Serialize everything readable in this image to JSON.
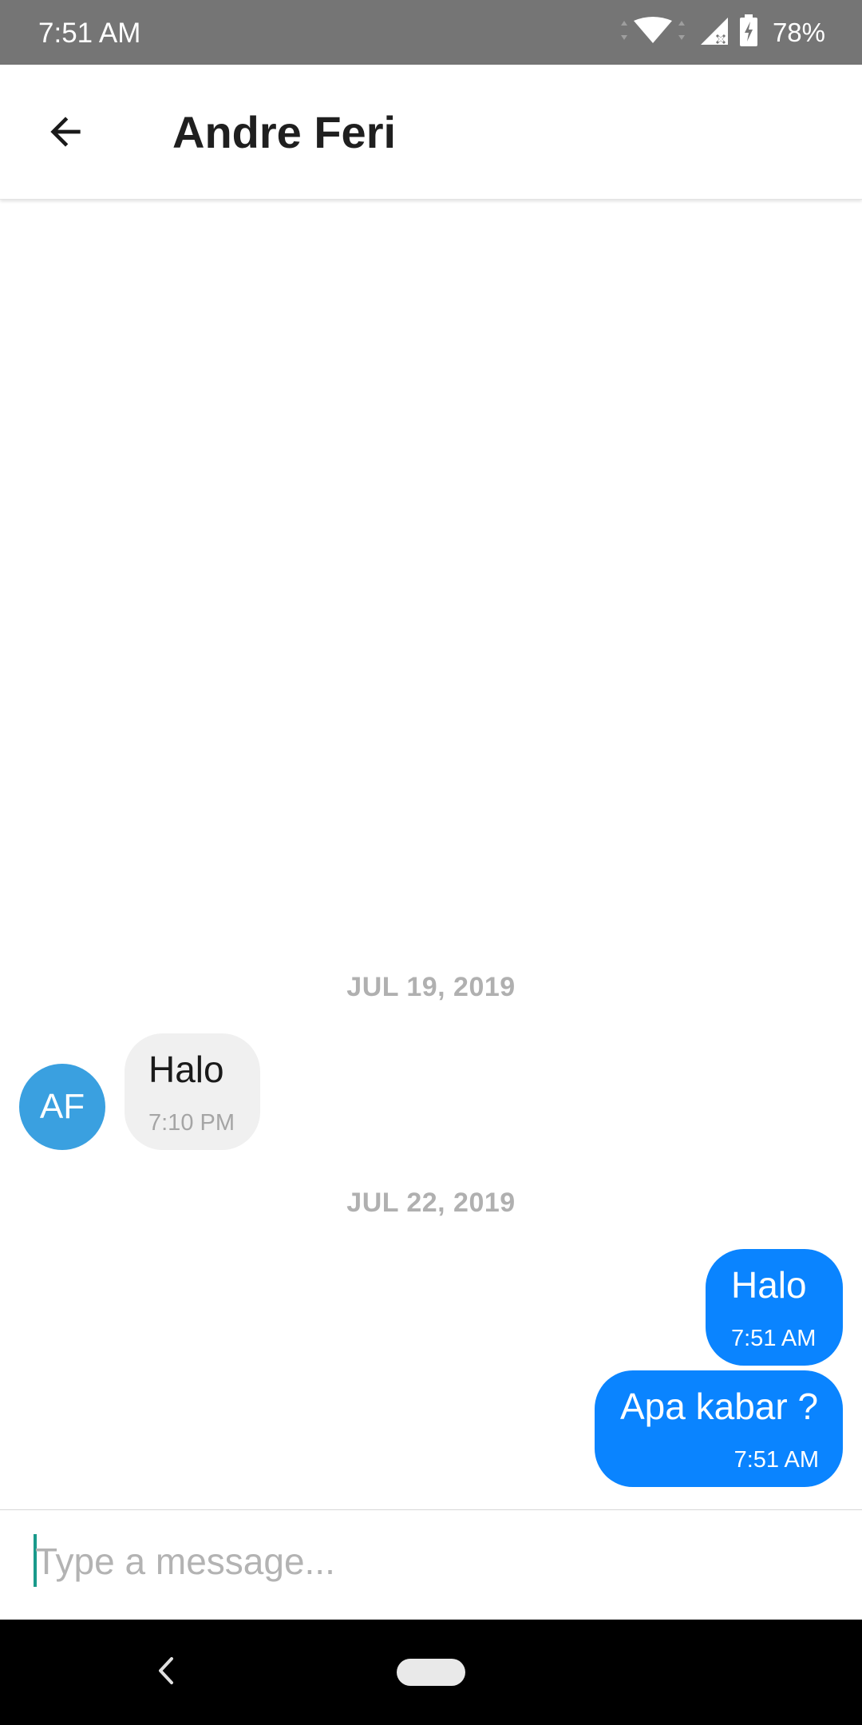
{
  "status_bar": {
    "time": "7:51 AM",
    "battery": "78%",
    "icons": [
      "wifi-icon",
      "signal-icon",
      "battery-charging-icon"
    ]
  },
  "header": {
    "back_icon": "arrow-left-icon",
    "contact_name": "Andre Feri"
  },
  "conversation": {
    "groups": [
      {
        "date": "JUL 19, 2019",
        "messages": [
          {
            "direction": "incoming",
            "avatar_initials": "AF",
            "text": "Halo",
            "time": "7:10 PM"
          }
        ]
      },
      {
        "date": "JUL 22, 2019",
        "messages": [
          {
            "direction": "outgoing",
            "text": "Halo",
            "time": "7:51 AM"
          },
          {
            "direction": "outgoing",
            "text": "Apa kabar ?",
            "time": "7:51 AM"
          }
        ]
      }
    ]
  },
  "composer": {
    "value": "",
    "placeholder": "Type a message..."
  },
  "nav_bar": {
    "icons": [
      "nav-back-icon",
      "home-pill-icon"
    ]
  },
  "colors": {
    "status_bar": "#757575",
    "outgoing_bubble": "#0a84ff",
    "incoming_bubble": "#f0f0f0",
    "avatar": "#3aa0e0",
    "date_separator": "#b0b0b0",
    "caret": "#199a8b"
  }
}
